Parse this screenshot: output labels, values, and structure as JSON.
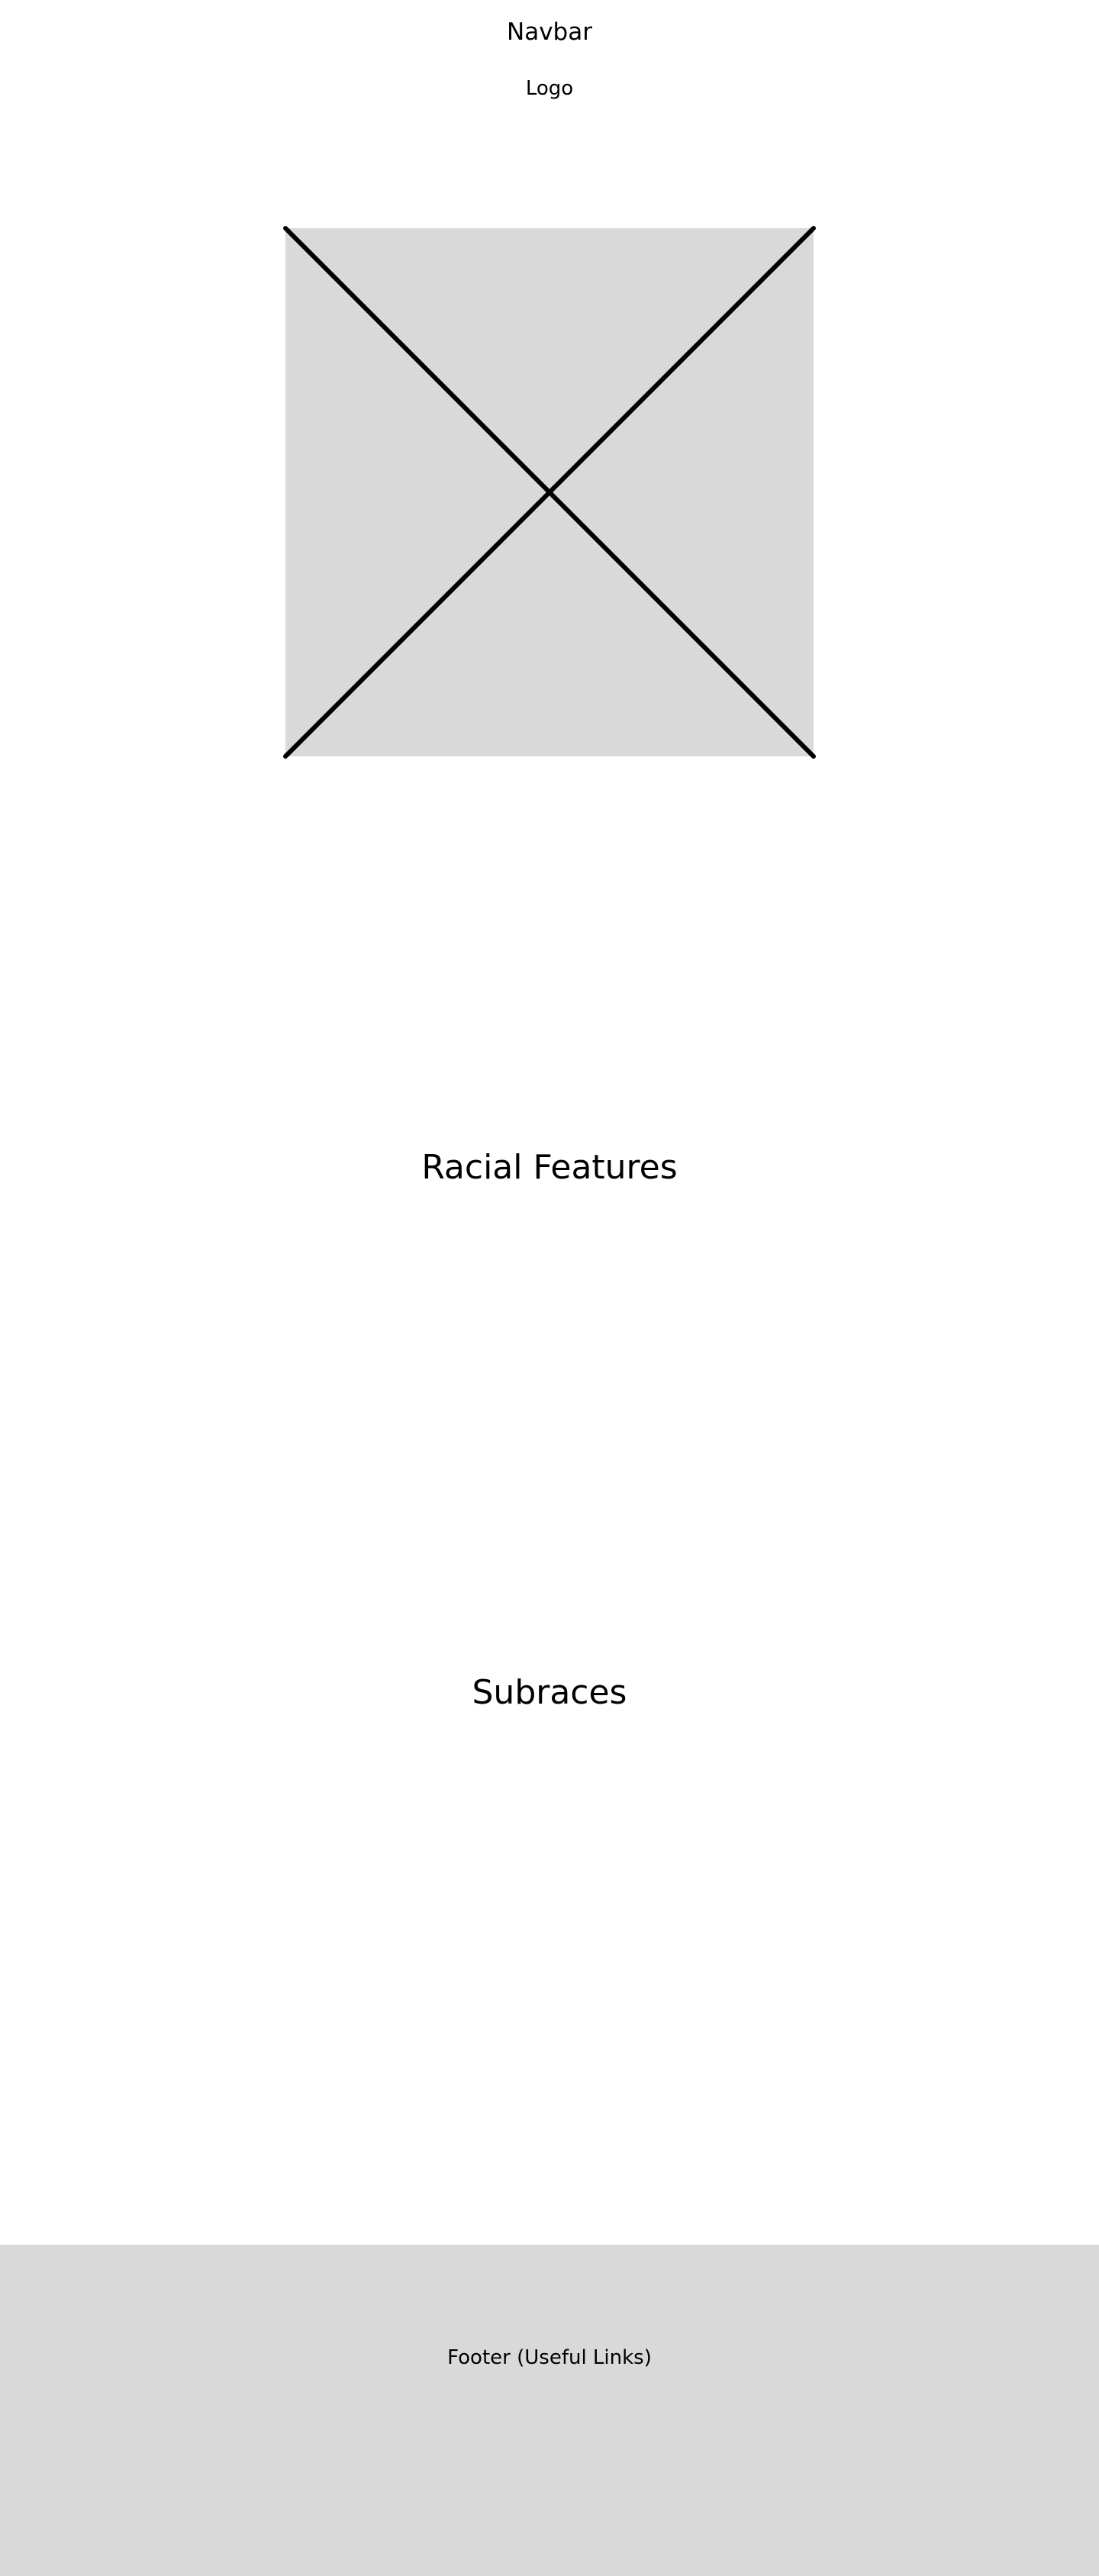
{
  "navbar": {
    "label": "Navbar"
  },
  "logo": {
    "label": "Logo"
  },
  "hero": {
    "placeholder_color": "#d9d9d9"
  },
  "sections": {
    "racial_features": {
      "title": "Racial Features"
    },
    "subraces": {
      "title": "Subraces"
    }
  },
  "footer": {
    "label": "Footer (Useful Links)",
    "background": "#d9d9d9"
  }
}
